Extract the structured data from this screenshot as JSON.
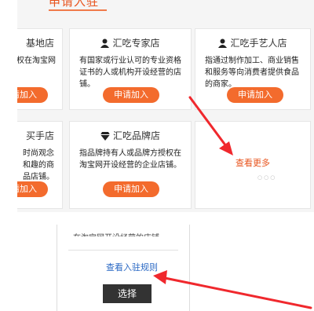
{
  "heading": "申请入驻",
  "apply_label": "申请加入",
  "cards": {
    "local_store": {
      "title": "基地店",
      "desc": "授权在淘宝网",
      "icon": "storefront-icon"
    },
    "expert_store": {
      "title": "汇吃专家店",
      "desc": "有国家或行业认可的专业资格证书的人或机构开设经营的店铺。",
      "icon": "person-icon"
    },
    "artisan_store": {
      "title": "汇吃手艺人店",
      "desc": "指通过制作加工、商业销售和服务等向消费者提供食品的商家。",
      "icon": "artisan-icon"
    },
    "buyer_store": {
      "title": "买手店",
      "desc": "时尚观念和趣的商品店铺。",
      "icon": "bag-icon"
    },
    "brand_store": {
      "title": "汇吃品牌店",
      "desc": "指品牌持有人或品牌方授权在淘宝网开设经营的企业店铺。",
      "icon": "diamond-icon"
    }
  },
  "more_label": "查看更多",
  "more_dots": "○○○",
  "bottom": {
    "cut_text": "在淘宝网开设经营的店铺。",
    "rules_label": "查看入驻规则",
    "select_label": "选择"
  },
  "colors": {
    "accent": "#f36b2d",
    "arrow": "#f0282d",
    "link": "#2a68c4",
    "dark_button": "#333333"
  }
}
